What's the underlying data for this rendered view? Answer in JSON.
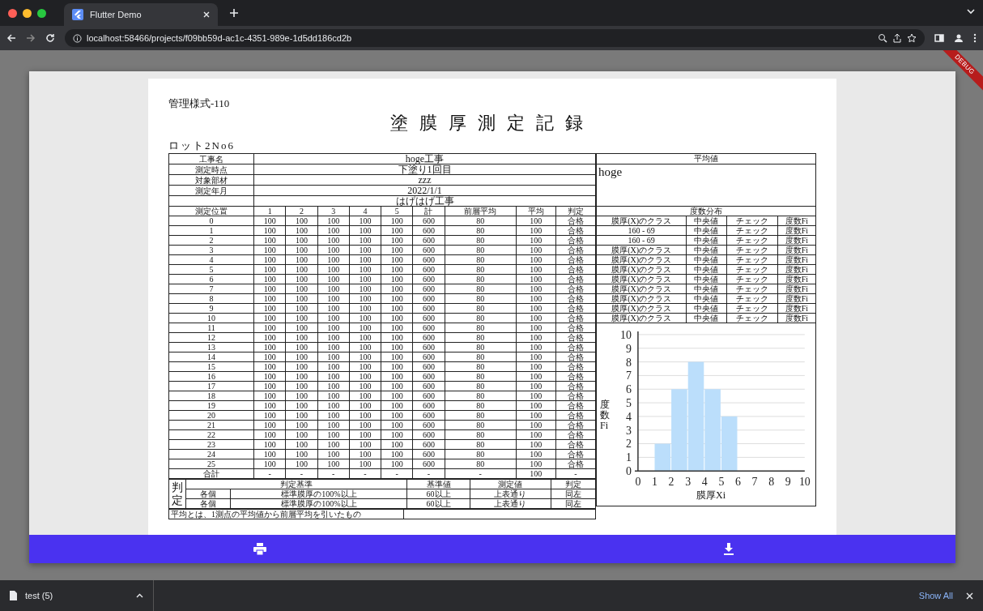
{
  "browser": {
    "tab_title": "Flutter Demo",
    "url": "localhost:58466/projects/f09bb59d-ac1c-4351-989e-1d5dd186cd2b"
  },
  "debug_banner": "DEBUG",
  "document": {
    "form_number": "管理様式-110",
    "title": "塗膜厚測定記録",
    "lot": "ロット2No6",
    "info": [
      {
        "label": "工事名",
        "value": "hoge工事"
      },
      {
        "label": "測定時点",
        "value": "下塗り1回目"
      },
      {
        "label": "対象部材",
        "value": "zzz"
      },
      {
        "label": "測定年月",
        "value": "2022/1/1"
      },
      {
        "value": "はげはげ工事"
      }
    ],
    "columns": [
      "測定位置",
      "1",
      "2",
      "3",
      "4",
      "5",
      "計",
      "前層平均",
      "平均",
      "判定"
    ],
    "rows": [
      [
        "0",
        "100",
        "100",
        "100",
        "100",
        "100",
        "600",
        "80",
        "100",
        "合格"
      ],
      [
        "1",
        "100",
        "100",
        "100",
        "100",
        "100",
        "600",
        "80",
        "100",
        "合格"
      ],
      [
        "2",
        "100",
        "100",
        "100",
        "100",
        "100",
        "600",
        "80",
        "100",
        "合格"
      ],
      [
        "3",
        "100",
        "100",
        "100",
        "100",
        "100",
        "600",
        "80",
        "100",
        "合格"
      ],
      [
        "4",
        "100",
        "100",
        "100",
        "100",
        "100",
        "600",
        "80",
        "100",
        "合格"
      ],
      [
        "5",
        "100",
        "100",
        "100",
        "100",
        "100",
        "600",
        "80",
        "100",
        "合格"
      ],
      [
        "6",
        "100",
        "100",
        "100",
        "100",
        "100",
        "600",
        "80",
        "100",
        "合格"
      ],
      [
        "7",
        "100",
        "100",
        "100",
        "100",
        "100",
        "600",
        "80",
        "100",
        "合格"
      ],
      [
        "8",
        "100",
        "100",
        "100",
        "100",
        "100",
        "600",
        "80",
        "100",
        "合格"
      ],
      [
        "9",
        "100",
        "100",
        "100",
        "100",
        "100",
        "600",
        "80",
        "100",
        "合格"
      ],
      [
        "10",
        "100",
        "100",
        "100",
        "100",
        "100",
        "600",
        "80",
        "100",
        "合格"
      ],
      [
        "11",
        "100",
        "100",
        "100",
        "100",
        "100",
        "600",
        "80",
        "100",
        "合格"
      ],
      [
        "12",
        "100",
        "100",
        "100",
        "100",
        "100",
        "600",
        "80",
        "100",
        "合格"
      ],
      [
        "13",
        "100",
        "100",
        "100",
        "100",
        "100",
        "600",
        "80",
        "100",
        "合格"
      ],
      [
        "14",
        "100",
        "100",
        "100",
        "100",
        "100",
        "600",
        "80",
        "100",
        "合格"
      ],
      [
        "15",
        "100",
        "100",
        "100",
        "100",
        "100",
        "600",
        "80",
        "100",
        "合格"
      ],
      [
        "16",
        "100",
        "100",
        "100",
        "100",
        "100",
        "600",
        "80",
        "100",
        "合格"
      ],
      [
        "17",
        "100",
        "100",
        "100",
        "100",
        "100",
        "600",
        "80",
        "100",
        "合格"
      ],
      [
        "18",
        "100",
        "100",
        "100",
        "100",
        "100",
        "600",
        "80",
        "100",
        "合格"
      ],
      [
        "19",
        "100",
        "100",
        "100",
        "100",
        "100",
        "600",
        "80",
        "100",
        "合格"
      ],
      [
        "20",
        "100",
        "100",
        "100",
        "100",
        "100",
        "600",
        "80",
        "100",
        "合格"
      ],
      [
        "21",
        "100",
        "100",
        "100",
        "100",
        "100",
        "600",
        "80",
        "100",
        "合格"
      ],
      [
        "22",
        "100",
        "100",
        "100",
        "100",
        "100",
        "600",
        "80",
        "100",
        "合格"
      ],
      [
        "23",
        "100",
        "100",
        "100",
        "100",
        "100",
        "600",
        "80",
        "100",
        "合格"
      ],
      [
        "24",
        "100",
        "100",
        "100",
        "100",
        "100",
        "600",
        "80",
        "100",
        "合格"
      ],
      [
        "25",
        "100",
        "100",
        "100",
        "100",
        "100",
        "600",
        "80",
        "100",
        "合格"
      ]
    ],
    "total": [
      "合計",
      "-",
      "-",
      "-",
      "-",
      "-",
      "-",
      "-",
      "100",
      "-"
    ],
    "average": {
      "header": "平均値",
      "value": "hoge"
    },
    "distribution": {
      "header": "度数分布",
      "rows": [
        [
          "膜厚(X)のクラス",
          "中央値",
          "チェック",
          "度数Fi"
        ],
        [
          "160 - 69",
          "中央値",
          "チェック",
          "度数Fi"
        ],
        [
          "160 - 69",
          "中央値",
          "チェック",
          "度数Fi"
        ],
        [
          "膜厚(X)のクラス",
          "中央値",
          "チェック",
          "度数Fi"
        ],
        [
          "膜厚(X)のクラス",
          "中央値",
          "チェック",
          "度数Fi"
        ],
        [
          "膜厚(X)のクラス",
          "中央値",
          "チェック",
          "度数Fi"
        ],
        [
          "膜厚(X)のクラス",
          "中央値",
          "チェック",
          "度数Fi"
        ],
        [
          "膜厚(X)のクラス",
          "中央値",
          "チェック",
          "度数Fi"
        ],
        [
          "膜厚(X)のクラス",
          "中央値",
          "チェック",
          "度数Fi"
        ],
        [
          "膜厚(X)のクラス",
          "中央値",
          "チェック",
          "度数Fi"
        ],
        [
          "膜厚(X)のクラス",
          "中央値",
          "チェック",
          "度数Fi"
        ]
      ]
    },
    "chart_data": {
      "type": "bar",
      "xlabel": "膜厚Xi",
      "ylabel": "度数Fi",
      "categories": [
        "0",
        "1",
        "2",
        "3",
        "4",
        "5",
        "6",
        "7",
        "8",
        "9",
        "10"
      ],
      "series": [
        {
          "color": "#bbdefb",
          "values": [
            0,
            2,
            6,
            8,
            6,
            4,
            0,
            0,
            0,
            0,
            null
          ]
        }
      ],
      "ylim": [
        0,
        10
      ],
      "yticks": [
        0,
        1,
        2,
        3,
        4,
        5,
        6,
        7,
        8,
        9,
        10
      ],
      "grid": true
    },
    "judgement": {
      "label": "判定",
      "header": [
        "判定基準",
        "基準値",
        "測定値",
        "判定"
      ],
      "rows": [
        [
          "各個",
          "標準膜厚の100%以上",
          "60以上",
          "上表通り",
          "同左"
        ],
        [
          "各個",
          "標準膜厚の100%以上",
          "60以上",
          "上表通り",
          "同左"
        ]
      ]
    },
    "note": "平均とは、1測点の平均値から前層平均を引いたもの"
  },
  "downloads": {
    "file": "test (5)",
    "show_all": "Show All"
  }
}
